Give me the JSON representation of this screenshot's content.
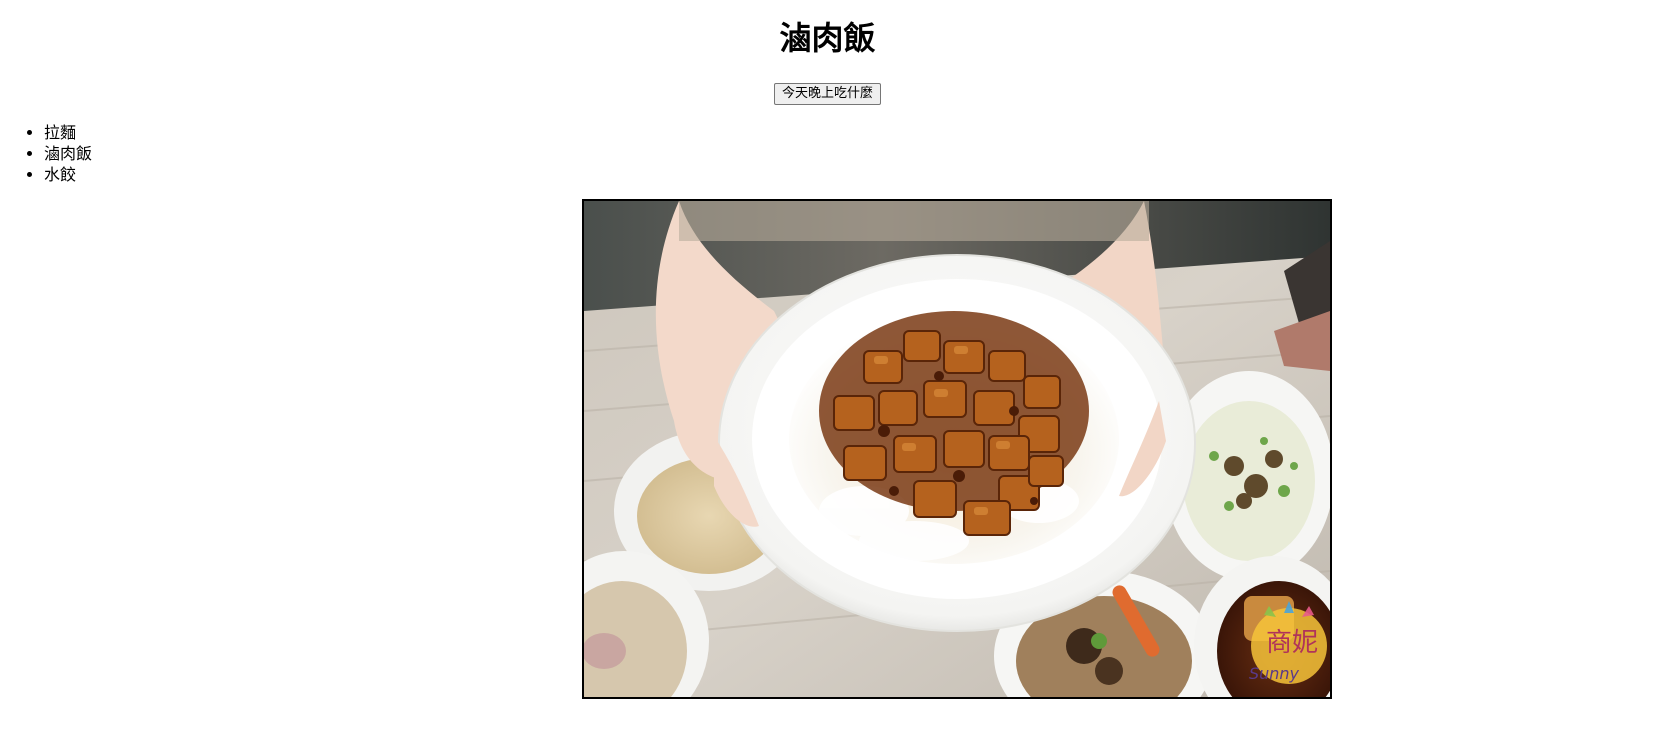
{
  "page": {
    "title": "滷肉飯"
  },
  "action_button": {
    "label": "今天晚上吃什麼"
  },
  "food_list": {
    "items": [
      "拉麵",
      "滷肉飯",
      "水餃"
    ]
  },
  "photo": {
    "subject": "braised pork rice bowl held in two hands",
    "watermark_text": "商妮",
    "watermark_sub": "Sunny"
  }
}
